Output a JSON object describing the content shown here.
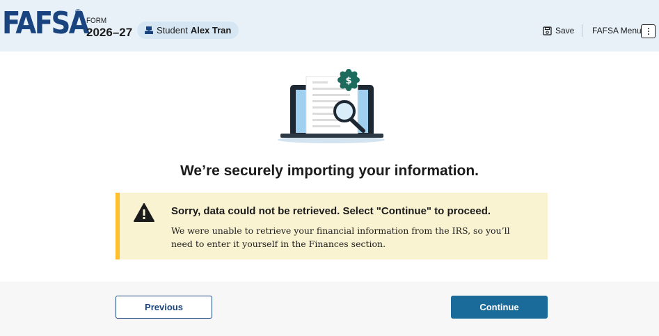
{
  "header": {
    "logo_text": "FAFSA",
    "registered_mark": "®",
    "form_label": "FORM",
    "form_year": "2026–27",
    "role_label": "Student",
    "user_name": "Alex Tran",
    "save_label": "Save",
    "menu_label": "FAFSA Menu"
  },
  "main": {
    "illustration_badge": "$",
    "heading": "We’re securely importing your information."
  },
  "alert": {
    "title": "Sorry, data could not be retrieved. Select \"Continue\" to proceed.",
    "body": "We were unable to retrieve your financial information from the IRS, so you’ll need to enter it yourself in the Finances section."
  },
  "footer": {
    "previous_label": "Previous",
    "continue_label": "Continue"
  },
  "colors": {
    "header_bg": "#e8f1f8",
    "brand_blue": "#1a4480",
    "continue_bg": "#1a6b99",
    "alert_bg": "#faf3d1",
    "alert_border": "#ffbe2e",
    "badge_green": "#1d6b5c"
  },
  "icons": [
    "graduation-cap-icon",
    "save-disk-icon",
    "kebab-menu-icon",
    "warning-icon",
    "dollar-badge-icon",
    "magnifier-icon"
  ]
}
